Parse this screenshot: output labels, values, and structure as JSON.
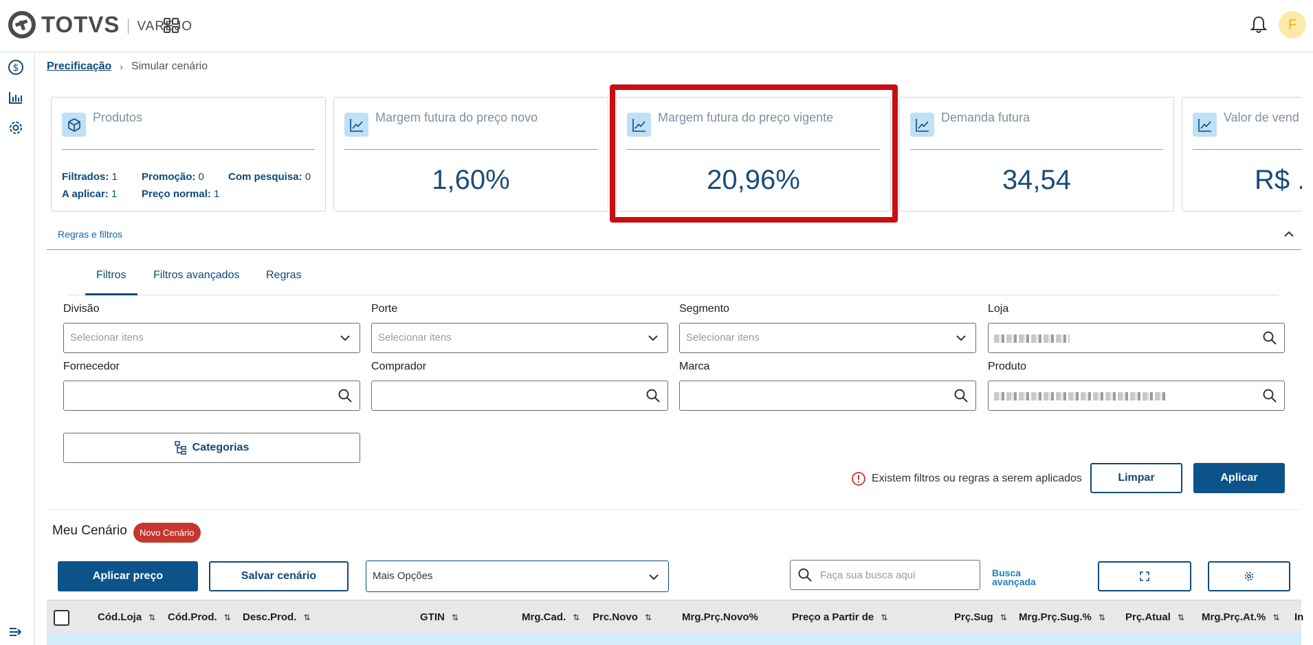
{
  "header": {
    "logo_text": "TOTVS",
    "logo_sub": "VAREJO",
    "apps_icon": "grid-icon",
    "notifications_icon": "bell-icon",
    "avatar_initial": "F"
  },
  "sidebar": {
    "items": [
      "dollar-circle-icon",
      "bar-chart-icon",
      "gear-icon",
      "expand-menu-icon"
    ]
  },
  "breadcrumb": {
    "parent": "Precificação",
    "current": "Simular cenário"
  },
  "cards": {
    "products": {
      "title": "Produtos",
      "filtered_label": "Filtrados:",
      "filtered_value": "1",
      "promo_label": "Promoção:",
      "promo_value": "0",
      "research_label": "Com pesquisa:",
      "research_value": "0",
      "apply_label": "A aplicar:",
      "apply_value": "1",
      "normal_label": "Preço normal:",
      "normal_value": "1"
    },
    "margin_new": {
      "title": "Margem futura do preço novo",
      "value": "1,60%"
    },
    "margin_current": {
      "title": "Margem futura do preço vigente",
      "value": "20,96%"
    },
    "demand": {
      "title": "Demanda futura",
      "value": "34,54"
    },
    "sales": {
      "title": "Valor de vend",
      "value": "R$ ."
    }
  },
  "rules": {
    "section_title": "Regras e filtros",
    "tabs": [
      "Filtros",
      "Filtros avançados",
      "Regras"
    ],
    "active_tab": "Filtros"
  },
  "filters": {
    "divisao": {
      "label": "Divisão",
      "placeholder": "Selecionar itens"
    },
    "porte": {
      "label": "Porte",
      "placeholder": "Selecionar itens"
    },
    "segmento": {
      "label": "Segmento",
      "placeholder": "Selecionar itens"
    },
    "loja": {
      "label": "Loja"
    },
    "fornecedor": {
      "label": "Fornecedor"
    },
    "comprador": {
      "label": "Comprador"
    },
    "marca": {
      "label": "Marca"
    },
    "produto": {
      "label": "Produto"
    },
    "categories_button": "Categorias",
    "warning": "Existem filtros ou regras a serem aplicados",
    "clear_button": "Limpar",
    "apply_button": "Aplicar"
  },
  "scenario": {
    "title": "Meu Cenário",
    "badge": "Novo Cenário",
    "apply_price_button": "Aplicar preço",
    "save_button": "Salvar cenário",
    "more_options": "Mais Opções",
    "search_placeholder": "Faça sua busca aqui",
    "advanced_search_line1": "Busca",
    "advanced_search_line2": "avançada"
  },
  "table": {
    "columns": [
      "Cód.Loja",
      "Cód.Prod.",
      "Desc.Prod.",
      "GTIN",
      "Mrg.Cad.",
      "Prc.Novo",
      "Mrg.Prç.Novo%",
      "Preço a Partir de",
      "Prç.Sug",
      "Mrg.Prç.Sug.%",
      "Prç.Atual",
      "Mrg.Prç.At.%",
      "In"
    ]
  },
  "colors": {
    "primary": "#0c5389",
    "highlight_border": "#c90d10",
    "badge": "#c4372e",
    "card_icon_bg": "#bfe0f5"
  }
}
